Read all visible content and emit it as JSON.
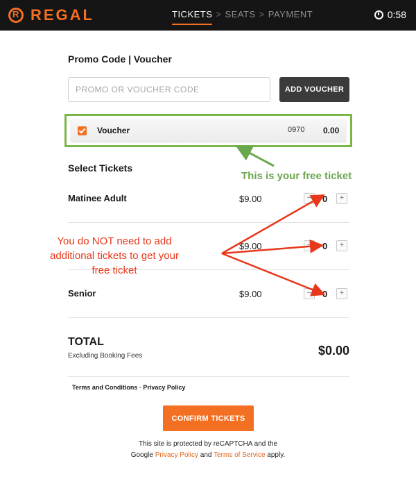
{
  "header": {
    "brand": "REGAL",
    "steps": [
      "TICKETS",
      "SEATS",
      "PAYMENT"
    ],
    "step_separator": ">",
    "active_step": "TICKETS",
    "timer": "0:58"
  },
  "promo": {
    "title": "Promo Code | Voucher",
    "placeholder": "PROMO OR VOUCHER CODE",
    "value": "",
    "add_button": "ADD VOUCHER"
  },
  "voucher": {
    "label": "Voucher",
    "code": "0970",
    "amount": "0.00",
    "checked": true
  },
  "tickets": {
    "title": "Select Tickets",
    "rows": [
      {
        "name": "Matinee Adult",
        "price": "$9.00",
        "quantity": "0"
      },
      {
        "name": "",
        "price": "$9.00",
        "quantity": "0"
      },
      {
        "name": "Senior",
        "price": "$9.00",
        "quantity": "0"
      }
    ],
    "minus_symbol": "−",
    "plus_symbol": "+"
  },
  "total": {
    "label": "TOTAL",
    "sublabel": "Excluding Booking Fees",
    "value": "$0.00"
  },
  "legal": {
    "terms": "Terms and Conditions",
    "separator": " · ",
    "privacy": "Privacy Policy"
  },
  "confirm_button": "CONFIRM TICKETS",
  "recaptcha": {
    "line1": "This site is protected by reCAPTCHA and the",
    "prefix": "Google ",
    "privacy_link": "Privacy Policy",
    "and": " and ",
    "terms_link": "Terms of Service",
    "suffix": " apply."
  },
  "annotations": {
    "green_note": "This is your free ticket",
    "red_note": "You do NOT need to add additional tickets to get your free ticket"
  },
  "colors": {
    "brand_orange": "#f36f21",
    "header_bg": "#151515",
    "annotation_green": "#6aa84f",
    "annotation_red": "#e8371a",
    "voucher_highlight": "#7ab648"
  }
}
